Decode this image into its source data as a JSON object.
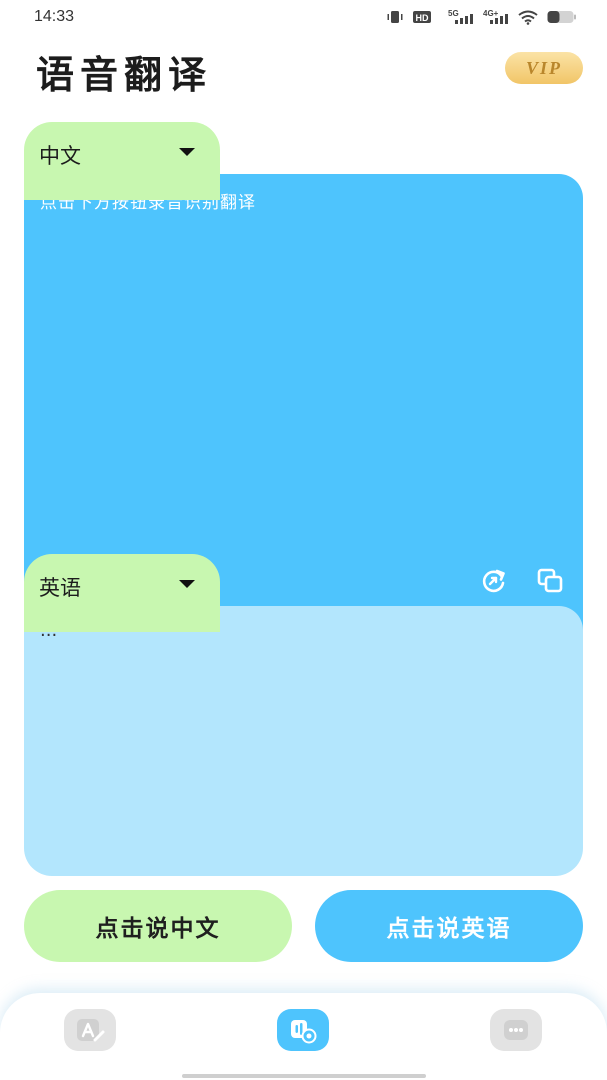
{
  "status_bar": {
    "time": "14:33",
    "icons": [
      "vibrate-icon",
      "hd-icon",
      "signal-5g-icon",
      "signal-4g-icon",
      "wifi-icon",
      "battery-icon"
    ],
    "hd_label": "HD",
    "network_5g": "5G",
    "network_4g": "4G+"
  },
  "header": {
    "title": "语音翻译",
    "vip_label": "VIP"
  },
  "source": {
    "language": "中文",
    "placeholder": "点击下方按钮录音识别翻译"
  },
  "target": {
    "language": "英语",
    "result": "..."
  },
  "buttons": {
    "speak_chinese": "点击说中文",
    "speak_english": "点击说英语"
  },
  "nav": {
    "items": [
      "text-translate-icon",
      "voice-translate-icon",
      "more-icon"
    ],
    "active": "voice-translate-icon"
  },
  "colors": {
    "accent_blue": "#4ec4fd",
    "light_blue": "#b3e6fd",
    "accent_green": "#c8f7b0",
    "vip_gold": "#f1c567"
  }
}
